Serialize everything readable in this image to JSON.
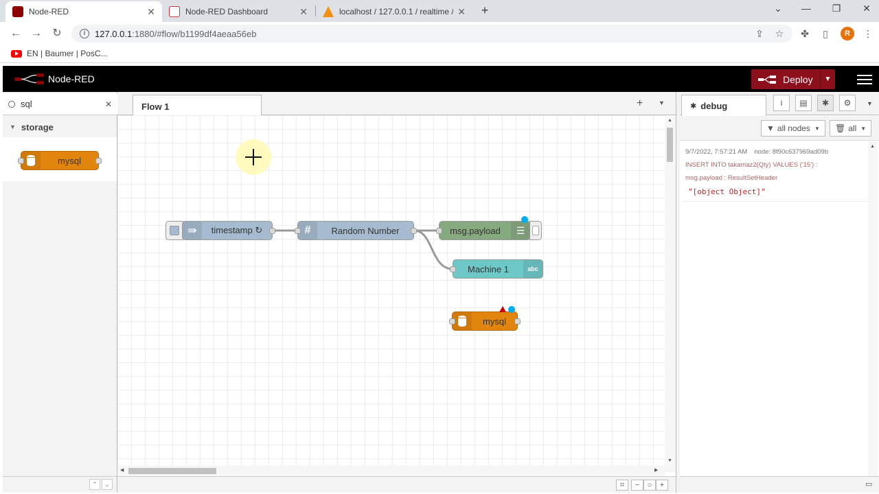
{
  "browser": {
    "tabs": [
      {
        "title": "Node-RED",
        "active": true
      },
      {
        "title": "Node-RED Dashboard",
        "active": false
      },
      {
        "title": "localhost / 127.0.0.1 / realtime / ",
        "active": false
      }
    ],
    "url_host": "127.0.0.1",
    "url_path": ":1880/#flow/b1199df4aeaa56eb",
    "profile_initial": "R",
    "bookmark": "EN | Baumer | PosC..."
  },
  "header": {
    "title": "Node-RED",
    "deploy_label": "Deploy"
  },
  "palette": {
    "search_value": "sql",
    "category": "storage",
    "nodes": [
      {
        "label": "mysql",
        "color": "#e2850e"
      }
    ]
  },
  "workspace": {
    "tab_label": "Flow 1",
    "nodes": [
      {
        "id": "timestamp",
        "label": "timestamp ↻",
        "color": "#a6bbcf"
      },
      {
        "id": "random",
        "label": "Random Number",
        "color": "#a6bbcf"
      },
      {
        "id": "debug",
        "label": "msg.payload",
        "color": "#87a980"
      },
      {
        "id": "machine",
        "label": "Machine 1",
        "color": "#6fc8c8",
        "icon_text": "abc"
      },
      {
        "id": "mysql",
        "label": "mysql",
        "color": "#e2850e"
      }
    ]
  },
  "sidebar": {
    "tab_label": "debug",
    "filter_nodes": "all nodes",
    "filter_level": "all",
    "messages": [
      {
        "timestamp": "9/7/2022, 7:57:21 AM",
        "node": "node: 8f90c637969ad09b",
        "topic": "INSERT INTO takamaz2(Qty) VALUES ('15') :",
        "property": "msg.payload : ResultSetHeader",
        "value": "\"[object Object]\""
      }
    ]
  },
  "colors": {
    "header_bg": "#000000",
    "deploy_bg": "#8c101c",
    "storage_node": "#e2850e",
    "function_node": "#a6bbcf",
    "debug_node": "#87a980",
    "dashboard_node": "#6fc8c8"
  }
}
